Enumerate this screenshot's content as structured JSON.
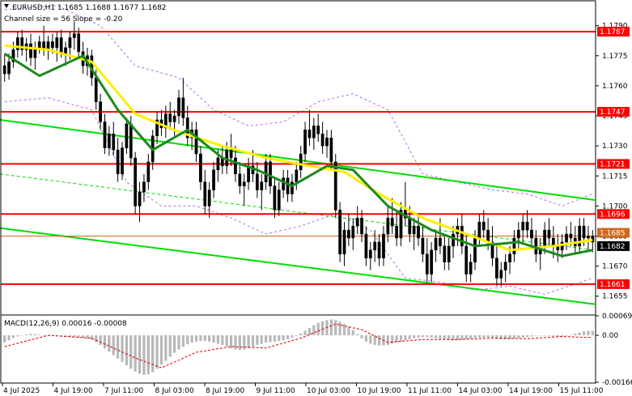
{
  "chart_data": {
    "type": "candlestick",
    "header": {
      "symbol_line": "EURUSD,H1  1.1685 1.1688 1.1677 1.1682",
      "channel_line": "Channel size = 56 Slope = -0.20"
    },
    "price_axis": {
      "ylim": [
        1.1646,
        1.1802
      ],
      "ticks": [
        "1.1790",
        "1.1775",
        "1.1760",
        "1.1745",
        "1.1730",
        "1.1715",
        "1.1700",
        "1.1685",
        "1.1670",
        "1.1655"
      ],
      "tick_values": [
        1.179,
        1.1775,
        1.176,
        1.1745,
        1.173,
        1.1715,
        1.17,
        1.1685,
        1.167,
        1.1655
      ]
    },
    "time_axis": {
      "labels": [
        "4 Jul 2025",
        "4 Jul 19:00",
        "7 Jul 11:00",
        "8 Jul 03:00",
        "8 Jul 19:00",
        "9 Jul 11:00",
        "10 Jul 03:00",
        "10 Jul 19:00",
        "11 Jul 11:00",
        "14 Jul 03:00",
        "14 Jul 19:00",
        "15 Jul 11:00"
      ]
    },
    "levels": [
      {
        "label": "1.1787",
        "value": 1.1787,
        "color": "#ff0000"
      },
      {
        "label": "1.1747",
        "value": 1.1747,
        "color": "#ff0000"
      },
      {
        "label": "1.1721",
        "value": 1.1721,
        "color": "#ff0000"
      },
      {
        "label": "1.1696",
        "value": 1.1696,
        "color": "#ff0000"
      },
      {
        "label": "1.1661",
        "value": 1.1661,
        "color": "#ff0000"
      }
    ],
    "price_tags": [
      {
        "label": "1.1685",
        "value": 1.1685,
        "color": "#d2691e"
      },
      {
        "label": "1.1682",
        "value": 1.1682,
        "color": "#000000"
      }
    ],
    "channel": {
      "color": "#00dd00",
      "upper": [
        [
          0,
          1.1743
        ],
        [
          135,
          1.1703
        ]
      ],
      "middle": [
        [
          0,
          1.1716
        ],
        [
          135,
          1.1678
        ]
      ],
      "lower": [
        [
          0,
          1.1689
        ],
        [
          135,
          1.1651
        ]
      ]
    },
    "candles": [
      [
        1.177,
        1.1776,
        1.1762,
        1.1766
      ],
      [
        1.1766,
        1.1776,
        1.1763,
        1.1772
      ],
      [
        1.1772,
        1.1782,
        1.1769,
        1.1778
      ],
      [
        1.1778,
        1.1787,
        1.1774,
        1.1784
      ],
      [
        1.1784,
        1.1788,
        1.1775,
        1.1778
      ],
      [
        1.1778,
        1.1784,
        1.1772,
        1.1781
      ],
      [
        1.1781,
        1.1786,
        1.177,
        1.1774
      ],
      [
        1.1774,
        1.1782,
        1.1768,
        1.1779
      ],
      [
        1.1779,
        1.1785,
        1.1776,
        1.1782
      ],
      [
        1.1782,
        1.179,
        1.1775,
        1.1778
      ],
      [
        1.1778,
        1.1785,
        1.1773,
        1.1782
      ],
      [
        1.1782,
        1.1786,
        1.1776,
        1.1779
      ],
      [
        1.1779,
        1.1787,
        1.1772,
        1.1784
      ],
      [
        1.1784,
        1.1788,
        1.1774,
        1.1776
      ],
      [
        1.1776,
        1.1782,
        1.177,
        1.1779
      ],
      [
        1.1779,
        1.1787,
        1.1773,
        1.1784
      ],
      [
        1.1784,
        1.1792,
        1.1778,
        1.1786
      ],
      [
        1.1786,
        1.1789,
        1.1774,
        1.1777
      ],
      [
        1.1777,
        1.1782,
        1.1766,
        1.177
      ],
      [
        1.177,
        1.1779,
        1.1765,
        1.1775
      ],
      [
        1.1775,
        1.1778,
        1.176,
        1.1764
      ],
      [
        1.1764,
        1.1768,
        1.1748,
        1.1752
      ],
      [
        1.1752,
        1.1756,
        1.1738,
        1.1742
      ],
      [
        1.1742,
        1.1746,
        1.1726,
        1.1729
      ],
      [
        1.1729,
        1.174,
        1.1725,
        1.1736
      ],
      [
        1.1736,
        1.1742,
        1.1725,
        1.1728
      ],
      [
        1.1728,
        1.1734,
        1.1712,
        1.1716
      ],
      [
        1.1716,
        1.1732,
        1.1713,
        1.1729
      ],
      [
        1.1729,
        1.1744,
        1.1726,
        1.1741
      ],
      [
        1.1741,
        1.1745,
        1.172,
        1.1724
      ],
      [
        1.1724,
        1.1727,
        1.1696,
        1.17
      ],
      [
        1.17,
        1.1712,
        1.1692,
        1.1707
      ],
      [
        1.1707,
        1.1716,
        1.1702,
        1.1712
      ],
      [
        1.1712,
        1.1726,
        1.1708,
        1.1722
      ],
      [
        1.1722,
        1.1738,
        1.1718,
        1.1735
      ],
      [
        1.1735,
        1.1747,
        1.1731,
        1.1743
      ],
      [
        1.1743,
        1.1748,
        1.1735,
        1.1739
      ],
      [
        1.1739,
        1.175,
        1.1734,
        1.1746
      ],
      [
        1.1746,
        1.1752,
        1.1738,
        1.1742
      ],
      [
        1.1742,
        1.1748,
        1.1735,
        1.1745
      ],
      [
        1.1745,
        1.1758,
        1.1741,
        1.1754
      ],
      [
        1.1754,
        1.1764,
        1.174,
        1.1744
      ],
      [
        1.1744,
        1.175,
        1.173,
        1.1734
      ],
      [
        1.1734,
        1.1742,
        1.1728,
        1.1738
      ],
      [
        1.1738,
        1.1742,
        1.1722,
        1.1726
      ],
      [
        1.1726,
        1.173,
        1.1708,
        1.1712
      ],
      [
        1.1712,
        1.1718,
        1.1696,
        1.17
      ],
      [
        1.17,
        1.1712,
        1.1694,
        1.1708
      ],
      [
        1.1708,
        1.1722,
        1.1704,
        1.1718
      ],
      [
        1.1718,
        1.1728,
        1.1712,
        1.1724
      ],
      [
        1.1724,
        1.173,
        1.1716,
        1.172
      ],
      [
        1.172,
        1.1732,
        1.1716,
        1.1728
      ],
      [
        1.1728,
        1.1736,
        1.172,
        1.1724
      ],
      [
        1.1724,
        1.173,
        1.1712,
        1.1716
      ],
      [
        1.1716,
        1.1722,
        1.1706,
        1.171
      ],
      [
        1.171,
        1.1716,
        1.17,
        1.1712
      ],
      [
        1.1712,
        1.1724,
        1.1708,
        1.172
      ],
      [
        1.172,
        1.1728,
        1.1712,
        1.1716
      ],
      [
        1.1716,
        1.1722,
        1.1704,
        1.1708
      ],
      [
        1.1708,
        1.1716,
        1.1698,
        1.1712
      ],
      [
        1.1712,
        1.1726,
        1.1708,
        1.1722
      ],
      [
        1.1722,
        1.1726,
        1.1706,
        1.171
      ],
      [
        1.171,
        1.1714,
        1.1694,
        1.1698
      ],
      [
        1.1698,
        1.1712,
        1.1695,
        1.1708
      ],
      [
        1.1708,
        1.1718,
        1.1704,
        1.1714
      ],
      [
        1.1714,
        1.1718,
        1.1702,
        1.1706
      ],
      [
        1.1706,
        1.1716,
        1.1702,
        1.1712
      ],
      [
        1.1712,
        1.1722,
        1.1708,
        1.1718
      ],
      [
        1.1718,
        1.173,
        1.1714,
        1.1726
      ],
      [
        1.1726,
        1.1742,
        1.1722,
        1.1738
      ],
      [
        1.1738,
        1.1748,
        1.173,
        1.1734
      ],
      [
        1.1734,
        1.1744,
        1.1728,
        1.174
      ],
      [
        1.174,
        1.1746,
        1.1732,
        1.1736
      ],
      [
        1.1736,
        1.1742,
        1.1726,
        1.173
      ],
      [
        1.173,
        1.1738,
        1.1724,
        1.1734
      ],
      [
        1.1734,
        1.1738,
        1.1718,
        1.1722
      ],
      [
        1.1722,
        1.1726,
        1.1694,
        1.1698
      ],
      [
        1.1698,
        1.1702,
        1.1672,
        1.1676
      ],
      [
        1.1676,
        1.1692,
        1.167,
        1.1688
      ],
      [
        1.1688,
        1.1696,
        1.168,
        1.1684
      ],
      [
        1.1684,
        1.1694,
        1.1678,
        1.169
      ],
      [
        1.169,
        1.17,
        1.1686,
        1.1694
      ],
      [
        1.1694,
        1.1698,
        1.1682,
        1.1686
      ],
      [
        1.1686,
        1.169,
        1.167,
        1.1674
      ],
      [
        1.1674,
        1.1682,
        1.1668,
        1.1678
      ],
      [
        1.1678,
        1.1688,
        1.1672,
        1.1682
      ],
      [
        1.1682,
        1.1686,
        1.167,
        1.1674
      ],
      [
        1.1674,
        1.169,
        1.167,
        1.1686
      ],
      [
        1.1686,
        1.17,
        1.1682,
        1.1694
      ],
      [
        1.1694,
        1.1704,
        1.1686,
        1.169
      ],
      [
        1.169,
        1.1698,
        1.168,
        1.1684
      ],
      [
        1.1684,
        1.1702,
        1.168,
        1.1698
      ],
      [
        1.1698,
        1.1712,
        1.169,
        1.1694
      ],
      [
        1.1694,
        1.17,
        1.1682,
        1.1686
      ],
      [
        1.1686,
        1.1694,
        1.1678,
        1.169
      ],
      [
        1.169,
        1.1696,
        1.168,
        1.1684
      ],
      [
        1.1684,
        1.169,
        1.1672,
        1.1676
      ],
      [
        1.1676,
        1.1684,
        1.1662,
        1.1666
      ],
      [
        1.1666,
        1.1682,
        1.1662,
        1.1678
      ],
      [
        1.1678,
        1.1688,
        1.1672,
        1.1684
      ],
      [
        1.1684,
        1.1694,
        1.1676,
        1.168
      ],
      [
        1.168,
        1.1686,
        1.1668,
        1.1672
      ],
      [
        1.1672,
        1.1684,
        1.1668,
        1.168
      ],
      [
        1.168,
        1.169,
        1.1674,
        1.1686
      ],
      [
        1.1686,
        1.1694,
        1.168,
        1.169
      ],
      [
        1.169,
        1.1696,
        1.1676,
        1.168
      ],
      [
        1.168,
        1.1686,
        1.1662,
        1.1666
      ],
      [
        1.1666,
        1.1676,
        1.1662,
        1.1672
      ],
      [
        1.1672,
        1.1688,
        1.1668,
        1.1684
      ],
      [
        1.1684,
        1.1696,
        1.168,
        1.1692
      ],
      [
        1.1692,
        1.1698,
        1.1684,
        1.1688
      ],
      [
        1.1688,
        1.1694,
        1.1678,
        1.1682
      ],
      [
        1.1682,
        1.169,
        1.167,
        1.1674
      ],
      [
        1.1674,
        1.168,
        1.166,
        1.1664
      ],
      [
        1.1664,
        1.1672,
        1.166,
        1.1668
      ],
      [
        1.1668,
        1.1676,
        1.1662,
        1.1672
      ],
      [
        1.1672,
        1.168,
        1.1666,
        1.1676
      ],
      [
        1.1676,
        1.1688,
        1.1672,
        1.1684
      ],
      [
        1.1684,
        1.1692,
        1.1678,
        1.1688
      ],
      [
        1.1688,
        1.1696,
        1.1682,
        1.1692
      ],
      [
        1.1692,
        1.1698,
        1.1684,
        1.1688
      ],
      [
        1.1688,
        1.1694,
        1.168,
        1.1684
      ],
      [
        1.1684,
        1.1688,
        1.1672,
        1.1676
      ],
      [
        1.1676,
        1.1684,
        1.1668,
        1.168
      ],
      [
        1.168,
        1.1692,
        1.1676,
        1.1688
      ],
      [
        1.1688,
        1.1694,
        1.168,
        1.1684
      ],
      [
        1.1684,
        1.169,
        1.1674,
        1.168
      ],
      [
        1.168,
        1.1686,
        1.1672,
        1.1678
      ],
      [
        1.1678,
        1.1686,
        1.1674,
        1.1682
      ],
      [
        1.1682,
        1.169,
        1.1678,
        1.1686
      ],
      [
        1.1686,
        1.1692,
        1.168,
        1.1684
      ],
      [
        1.1684,
        1.169,
        1.1676,
        1.168
      ],
      [
        1.168,
        1.1694,
        1.1676,
        1.169
      ],
      [
        1.169,
        1.1694,
        1.168,
        1.1684
      ],
      [
        1.1684,
        1.169,
        1.1678,
        1.1685
      ],
      [
        1.1685,
        1.1688,
        1.1677,
        1.1682
      ]
    ],
    "ma_yellow": [
      [
        0,
        1.178
      ],
      [
        10,
        1.1778
      ],
      [
        20,
        1.1772
      ],
      [
        30,
        1.1746
      ],
      [
        40,
        1.1737
      ],
      [
        50,
        1.173
      ],
      [
        60,
        1.1724
      ],
      [
        70,
        1.172
      ],
      [
        78,
        1.1717
      ],
      [
        86,
        1.1706
      ],
      [
        96,
        1.1694
      ],
      [
        106,
        1.1686
      ],
      [
        116,
        1.1678
      ],
      [
        126,
        1.168
      ],
      [
        135,
        1.1683
      ]
    ],
    "ma_green": [
      [
        0,
        1.1776
      ],
      [
        8,
        1.1765
      ],
      [
        18,
        1.1775
      ],
      [
        26,
        1.1748
      ],
      [
        34,
        1.1728
      ],
      [
        42,
        1.1738
      ],
      [
        50,
        1.1724
      ],
      [
        58,
        1.1718
      ],
      [
        66,
        1.171
      ],
      [
        74,
        1.172
      ],
      [
        80,
        1.1718
      ],
      [
        88,
        1.17
      ],
      [
        98,
        1.1688
      ],
      [
        108,
        1.168
      ],
      [
        118,
        1.1682
      ],
      [
        128,
        1.1675
      ],
      [
        135,
        1.1678
      ]
    ],
    "envelope_upper": [
      [
        0,
        1.1798
      ],
      [
        12,
        1.18
      ],
      [
        22,
        1.179
      ],
      [
        30,
        1.177
      ],
      [
        40,
        1.1764
      ],
      [
        48,
        1.1748
      ],
      [
        56,
        1.174
      ],
      [
        64,
        1.1742
      ],
      [
        72,
        1.1752
      ],
      [
        80,
        1.1756
      ],
      [
        88,
        1.1748
      ],
      [
        96,
        1.1716
      ],
      [
        104,
        1.1712
      ],
      [
        112,
        1.1708
      ],
      [
        120,
        1.1706
      ],
      [
        128,
        1.17
      ],
      [
        135,
        1.1706
      ]
    ],
    "envelope_lower": [
      [
        0,
        1.1752
      ],
      [
        10,
        1.1754
      ],
      [
        20,
        1.1748
      ],
      [
        28,
        1.1712
      ],
      [
        36,
        1.17
      ],
      [
        44,
        1.17
      ],
      [
        52,
        1.1694
      ],
      [
        60,
        1.1686
      ],
      [
        68,
        1.169
      ],
      [
        76,
        1.1696
      ],
      [
        84,
        1.1688
      ],
      [
        92,
        1.1664
      ],
      [
        100,
        1.1662
      ],
      [
        108,
        1.1658
      ],
      [
        116,
        1.166
      ],
      [
        124,
        1.1656
      ],
      [
        135,
        1.1664
      ]
    ],
    "macd": {
      "label": "MACD(12,26,9) 0.00016 -0.00008",
      "ylim": [
        -0.00166,
        0.00069
      ],
      "ticks": [
        "0.00069",
        "0.00",
        "-0.00166"
      ],
      "tick_values": [
        0.00069,
        0.0,
        -0.00166
      ],
      "histogram": [
        -0.00025,
        -0.00018,
        -0.0001,
        -4e-05,
        0.0,
        3e-05,
        5e-05,
        4e-05,
        2e-05,
        0.0,
        -1e-05,
        -2e-05,
        -3e-05,
        -4e-05,
        -5e-05,
        -6e-05,
        -7e-05,
        -8e-05,
        -0.0001,
        -0.00012,
        -0.00016,
        -0.00024,
        -0.00034,
        -0.00046,
        -0.00058,
        -0.0007,
        -0.00082,
        -0.00094,
        -0.00106,
        -0.00118,
        -0.00128,
        -0.00136,
        -0.0014,
        -0.00138,
        -0.0013,
        -0.00118,
        -0.00104,
        -0.0009,
        -0.00076,
        -0.00062,
        -0.0005,
        -0.0004,
        -0.00032,
        -0.00026,
        -0.00022,
        -0.0002,
        -0.0002,
        -0.00022,
        -0.00026,
        -0.0003,
        -0.00034,
        -0.0004,
        -0.00046,
        -0.0005,
        -0.00052,
        -0.0005,
        -0.00046,
        -0.0004,
        -0.00034,
        -0.0003,
        -0.00026,
        -0.00024,
        -0.00022,
        -0.0002,
        -0.00018,
        -0.00014,
        -8e-05,
        -2e-05,
        6e-05,
        0.00016,
        0.00026,
        0.00036,
        0.00044,
        0.0005,
        0.00054,
        0.00056,
        0.00054,
        0.00048,
        0.0004,
        0.0003,
        0.00018,
        4e-05,
        -0.0001,
        -0.00022,
        -0.0003,
        -0.00034,
        -0.00036,
        -0.00036,
        -0.00034,
        -0.0003,
        -0.00026,
        -0.00022,
        -0.00018,
        -0.00014,
        -0.0001,
        -8e-05,
        -6e-05,
        -6e-05,
        -8e-05,
        -0.0001,
        -0.00012,
        -0.00014,
        -0.00016,
        -0.00018,
        -0.00018,
        -0.00016,
        -0.00014,
        -0.00012,
        -0.0001,
        -8e-05,
        -8e-05,
        -8e-05,
        -0.0001,
        -0.00012,
        -0.00014,
        -0.00014,
        -0.00014,
        -0.00012,
        -0.0001,
        -8e-05,
        -6e-05,
        -4e-05,
        -2e-05,
        0.0,
        0.0,
        -2e-05,
        -4e-05,
        -6e-05,
        -4e-05,
        -2e-05,
        2e-05,
        6e-05,
        0.0001,
        0.00014,
        0.00016,
        0.00016
      ],
      "signal": [
        [
          0,
          -0.0004
        ],
        [
          10,
          0.0
        ],
        [
          20,
          -0.0001
        ],
        [
          30,
          -0.0008
        ],
        [
          36,
          -0.00115
        ],
        [
          44,
          -0.0006
        ],
        [
          52,
          -0.0004
        ],
        [
          60,
          -0.00045
        ],
        [
          68,
          -0.0001
        ],
        [
          76,
          0.0004
        ],
        [
          82,
          0.0002
        ],
        [
          88,
          -0.00025
        ],
        [
          96,
          -0.00015
        ],
        [
          104,
          -0.00015
        ],
        [
          112,
          -0.0001
        ],
        [
          120,
          -0.00012
        ],
        [
          128,
          -4e-05
        ],
        [
          135,
          -8e-05
        ]
      ]
    }
  }
}
